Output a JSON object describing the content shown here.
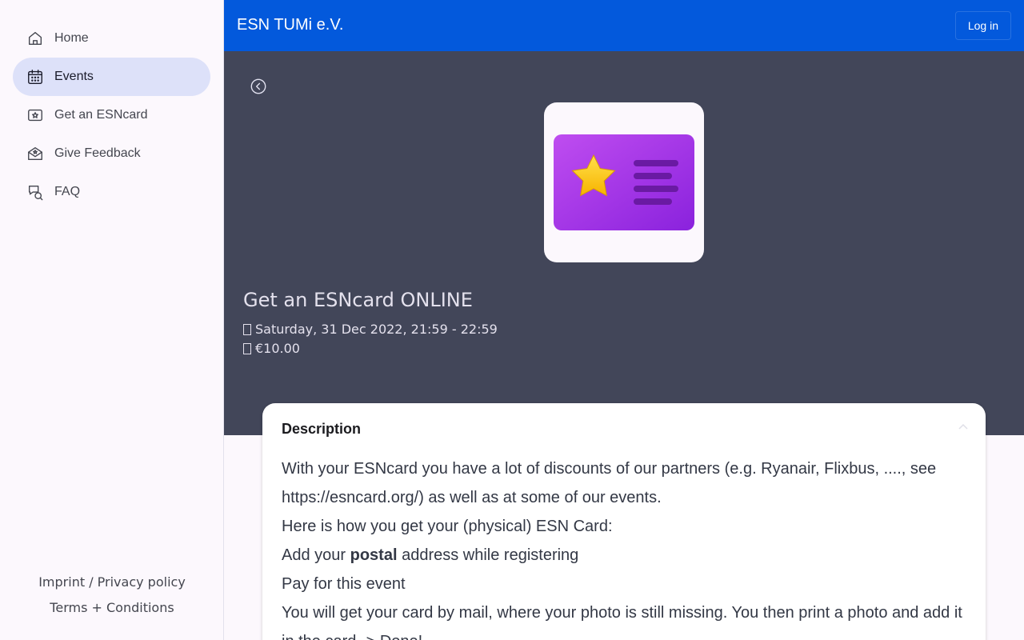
{
  "sidebar": {
    "items": [
      {
        "label": "Home",
        "icon": "home-icon"
      },
      {
        "label": "Events",
        "icon": "calendar-icon",
        "active": true
      },
      {
        "label": "Get an ESNcard",
        "icon": "card-star-icon"
      },
      {
        "label": "Give Feedback",
        "icon": "feedback-mail-icon"
      },
      {
        "label": "FAQ",
        "icon": "faq-chat-icon"
      }
    ],
    "footer": {
      "imprint": "Imprint / Privacy policy",
      "terms": "Terms + Conditions"
    }
  },
  "topbar": {
    "brand": "ESN TUMi e.V.",
    "login_label": "Log in",
    "color": "#0359dc"
  },
  "event": {
    "back_icon": "back-circle-icon",
    "image_icon": "esncard-icon",
    "title": "Get an ESNcard ONLINE",
    "date_icon": "calendar-glyph",
    "date": "Saturday, 31 Dec 2022, 21:59 - 22:59",
    "price_icon": "price-glyph",
    "price": "€10.00"
  },
  "description": {
    "heading": "Description",
    "collapse_icon": "chevron-up-icon",
    "line1": "With your ESNcard you have a lot of discounts of our partners (e.g. Ryanair, Flixbus, ...., see https://esncard.org/) as well as at some of our events.",
    "line2": "Here is how you get your (physical) ESN Card:",
    "line3_before": "Add your ",
    "line3_bold": "postal",
    "line3_after": " address while registering",
    "line4": "Pay for this event",
    "line5": "You will get your card by mail, where your photo is still missing. You then print a photo and add it in the card -> Done!"
  }
}
